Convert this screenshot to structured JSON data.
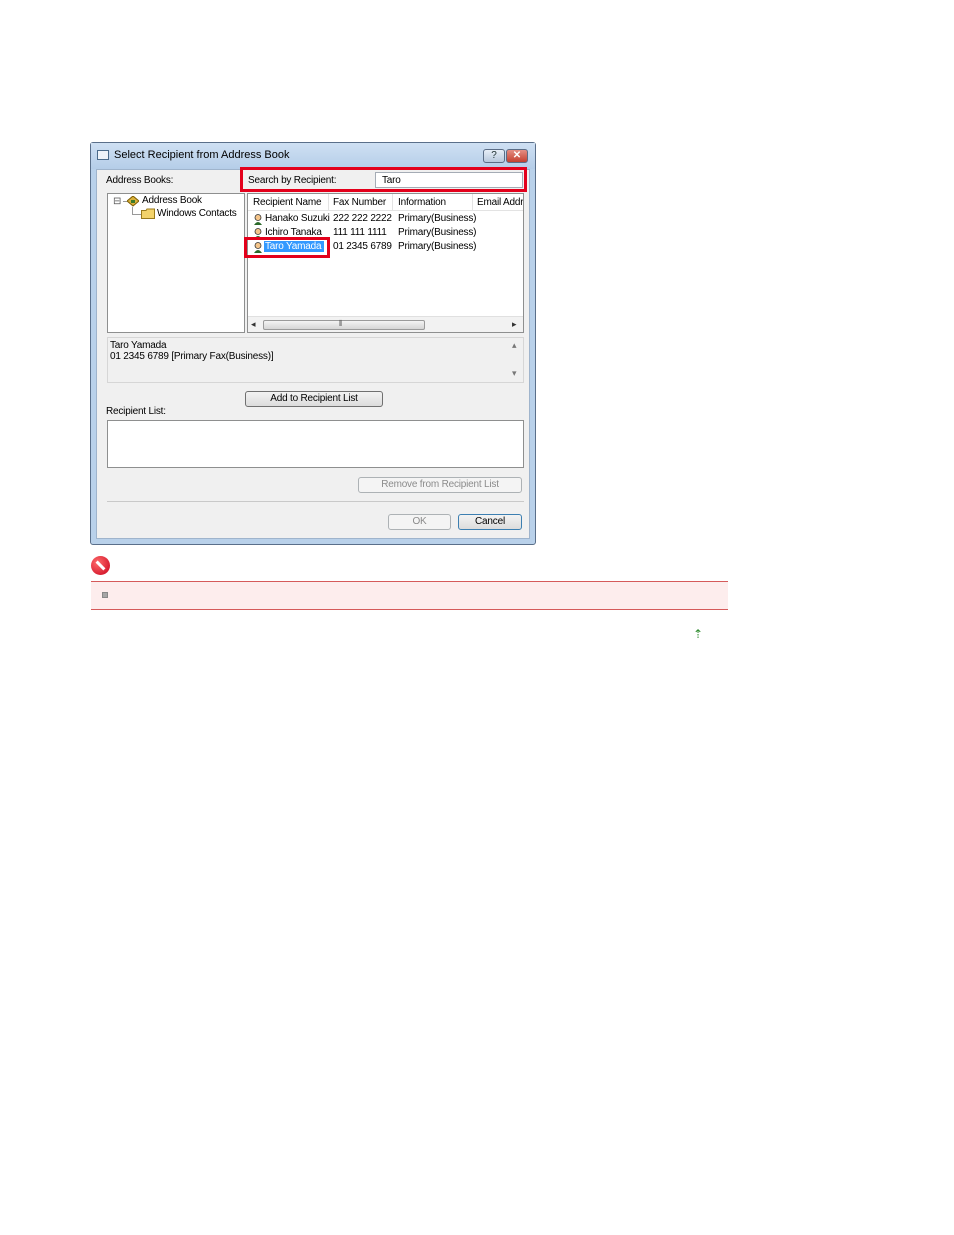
{
  "dialog": {
    "title": "Select Recipient from Address Book",
    "help_label": "?",
    "close_label": "✕"
  },
  "address_books": {
    "label": "Address Books:",
    "tree": [
      {
        "label": "Address Book",
        "expander": "⊟"
      },
      {
        "label": "Windows Contacts"
      }
    ]
  },
  "search": {
    "label": "Search by Recipient:",
    "value": "Taro"
  },
  "list": {
    "columns": [
      "Recipient Name",
      "Fax Number",
      "Information",
      "Email Addre"
    ],
    "rows": [
      {
        "name": "Hanako Suzuki",
        "fax": "222 222 2222",
        "info": "Primary(Business)",
        "selected": false
      },
      {
        "name": "Ichiro Tanaka",
        "fax": "111 111 1111",
        "info": "Primary(Business)",
        "selected": false
      },
      {
        "name": "Taro Yamada",
        "fax": "01 2345 6789",
        "info": "Primary(Business)",
        "selected": true
      }
    ],
    "scroll_left": "◂",
    "scroll_right": "▸",
    "scroll_grip": "⦀"
  },
  "detail": {
    "line1": "Taro Yamada",
    "line2": "01 2345 6789 [Primary Fax(Business)]",
    "scroll_up": "▴",
    "scroll_down": "▾"
  },
  "buttons": {
    "add": "Add to Recipient List",
    "remove": "Remove from Recipient List",
    "ok": "OK",
    "cancel": "Cancel"
  },
  "recipient_list": {
    "label": "Recipient List:"
  },
  "page": {
    "top_link": "⇡"
  },
  "colors": {
    "highlight": "#e3001b",
    "selection": "#3399ff",
    "note_background": "#fdeded"
  }
}
